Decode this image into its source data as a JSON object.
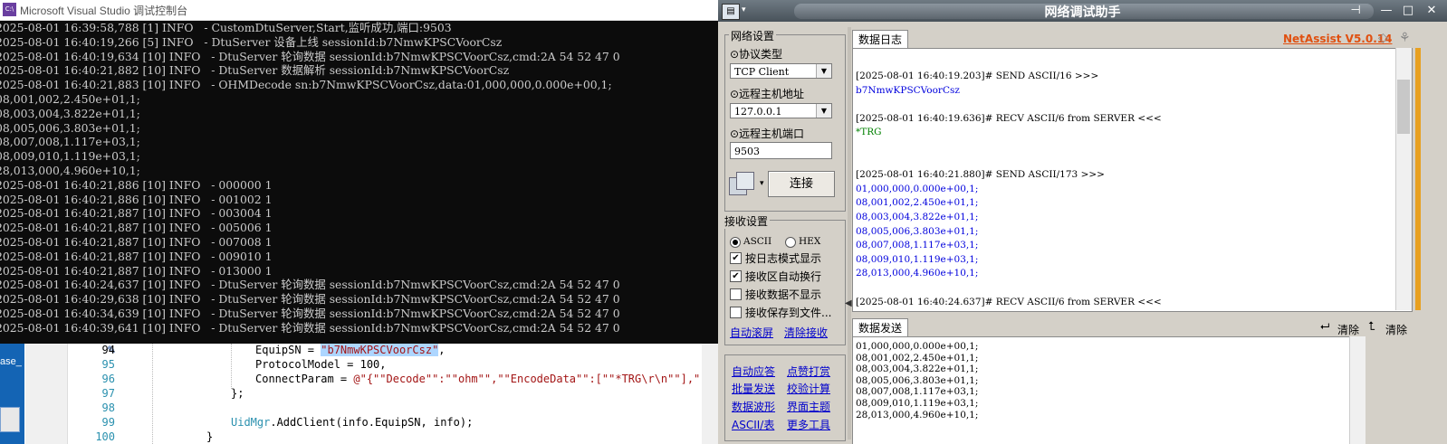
{
  "console": {
    "title": "Microsoft Visual Studio 调试控制台",
    "lines": [
      "2025-08-01 16:39:58,788 [1] INFO   - CustomDtuServer,Start,监听成功,端口:9503",
      "2025-08-01 16:40:19,266 [5] INFO   - DtuServer 设备上线 sessionId:b7NmwKPSCVoorCsz",
      "2025-08-01 16:40:19,634 [10] INFO   - DtuServer 轮询数据 sessionId:b7NmwKPSCVoorCsz,cmd:2A 54 52 47 0",
      "2025-08-01 16:40:21,882 [10] INFO   - DtuServer 数据解析 sessionId:b7NmwKPSCVoorCsz",
      "2025-08-01 16:40:21,883 [10] INFO   - OHMDecode sn:b7NmwKPSCVoorCsz,data:01,000,000,0.000e+00,1;",
      "08,001,002,2.450e+01,1;",
      "08,003,004,3.822e+01,1;",
      "08,005,006,3.803e+01,1;",
      "08,007,008,1.117e+03,1;",
      "08,009,010,1.119e+03,1;",
      "28,013,000,4.960e+10,1;",
      "2025-08-01 16:40:21,886 [10] INFO   - 000000 1",
      "2025-08-01 16:40:21,886 [10] INFO   - 001002 1",
      "2025-08-01 16:40:21,887 [10] INFO   - 003004 1",
      "2025-08-01 16:40:21,887 [10] INFO   - 005006 1",
      "2025-08-01 16:40:21,887 [10] INFO   - 007008 1",
      "2025-08-01 16:40:21,887 [10] INFO   - 009010 1",
      "2025-08-01 16:40:21,887 [10] INFO   - 013000 1",
      "2025-08-01 16:40:24,637 [10] INFO   - DtuServer 轮询数据 sessionId:b7NmwKPSCVoorCsz,cmd:2A 54 52 47 0",
      "2025-08-01 16:40:29,638 [10] INFO   - DtuServer 轮询数据 sessionId:b7NmwKPSCVoorCsz,cmd:2A 54 52 47 0",
      "2025-08-01 16:40:34,639 [10] INFO   - DtuServer 轮询数据 sessionId:b7NmwKPSCVoorCsz,cmd:2A 54 52 47 0",
      "2025-08-01 16:40:39,641 [10] INFO   - DtuServer 轮询数据 sessionId:b7NmwKPSCVoorCsz,cmd:2A 54 52 47 0"
    ]
  },
  "desktop": {
    "label": "ase_"
  },
  "editor": {
    "line_numbers": [
      "94",
      "95",
      "96",
      "97",
      "98",
      "99",
      "100"
    ],
    "code94_a": "EquipSN = ",
    "code94_b": "\"b7NmwKPSCVoorCsz\"",
    "code94_c": ",",
    "code95": "ProtocolModel = 100,",
    "code96_a": "ConnectParam = ",
    "code96_b": "@\"{\"\"Decode\"\":\"\"ohm\"\",\"\"EncodeData\"\":[\"\"*TRG\\r\\n\"\"],\"\"Enco",
    "code97": "};",
    "code99_a": "UidMgr",
    "code99_b": ".AddClient(info.EquipSN, info);",
    "code100": "}"
  },
  "net": {
    "title": "网络调试助手",
    "brand": "NetAssist V5.0.14",
    "net_settings": "网络设置",
    "protocol_label": "⊙协议类型",
    "protocol_value": "TCP Client",
    "host_label": "⊙远程主机地址",
    "host_value": "127.0.0.1",
    "port_label": "⊙远程主机端口",
    "port_value": "9503",
    "connect": "连接",
    "recv_settings": "接收设置",
    "ascii": "ASCII",
    "hex": "HEX",
    "opt1": "按日志模式显示",
    "opt2": "接收区自动换行",
    "opt3": "接收数据不显示",
    "opt4": "接收保存到文件...",
    "auto_scroll": "自动滚屏",
    "clear_recv": "清除接收",
    "links": [
      "自动应答",
      "点赞打赏",
      "批量发送",
      "校验计算",
      "数据波形",
      "界面主题",
      "ASCII/表",
      "更多工具"
    ],
    "log_tab": "数据日志",
    "send_tab": "数据发送",
    "clear1": "清除",
    "clear2": "清除",
    "log": [
      {
        "t": "[2025-08-01 16:40:19.203]# SEND ASCII/16 >>>",
        "c": "#000"
      },
      {
        "t": "b7NmwKPSCVoorCsz",
        "c": "#0000dd"
      },
      {
        "t": "",
        "c": "#000"
      },
      {
        "t": "[2025-08-01 16:40:19.636]# RECV ASCII/6 from SERVER <<<",
        "c": "#000"
      },
      {
        "t": "*TRG",
        "c": "#008000"
      },
      {
        "t": "",
        "c": "#000"
      },
      {
        "t": "",
        "c": "#000"
      },
      {
        "t": "[2025-08-01 16:40:21.880]# SEND ASCII/173 >>>",
        "c": "#000"
      },
      {
        "t": "01,000,000,0.000e+00,1;",
        "c": "#0000dd"
      },
      {
        "t": "08,001,002,2.450e+01,1;",
        "c": "#0000dd"
      },
      {
        "t": "08,003,004,3.822e+01,1;",
        "c": "#0000dd"
      },
      {
        "t": "08,005,006,3.803e+01,1;",
        "c": "#0000dd"
      },
      {
        "t": "08,007,008,1.117e+03,1;",
        "c": "#0000dd"
      },
      {
        "t": "08,009,010,1.119e+03,1;",
        "c": "#0000dd"
      },
      {
        "t": "28,013,000,4.960e+10,1;",
        "c": "#0000dd"
      },
      {
        "t": "",
        "c": "#000"
      },
      {
        "t": "[2025-08-01 16:40:24.637]# RECV ASCII/6 from SERVER <<<",
        "c": "#000"
      }
    ],
    "send_lines": [
      "01,000,000,0.000e+00,1;",
      "08,001,002,2.450e+01,1;",
      "08,003,004,3.822e+01,1;",
      "08,005,006,3.803e+01,1;",
      "08,007,008,1.117e+03,1;",
      "08,009,010,1.119e+03,1;",
      "28,013,000,4.960e+10,1;"
    ]
  }
}
